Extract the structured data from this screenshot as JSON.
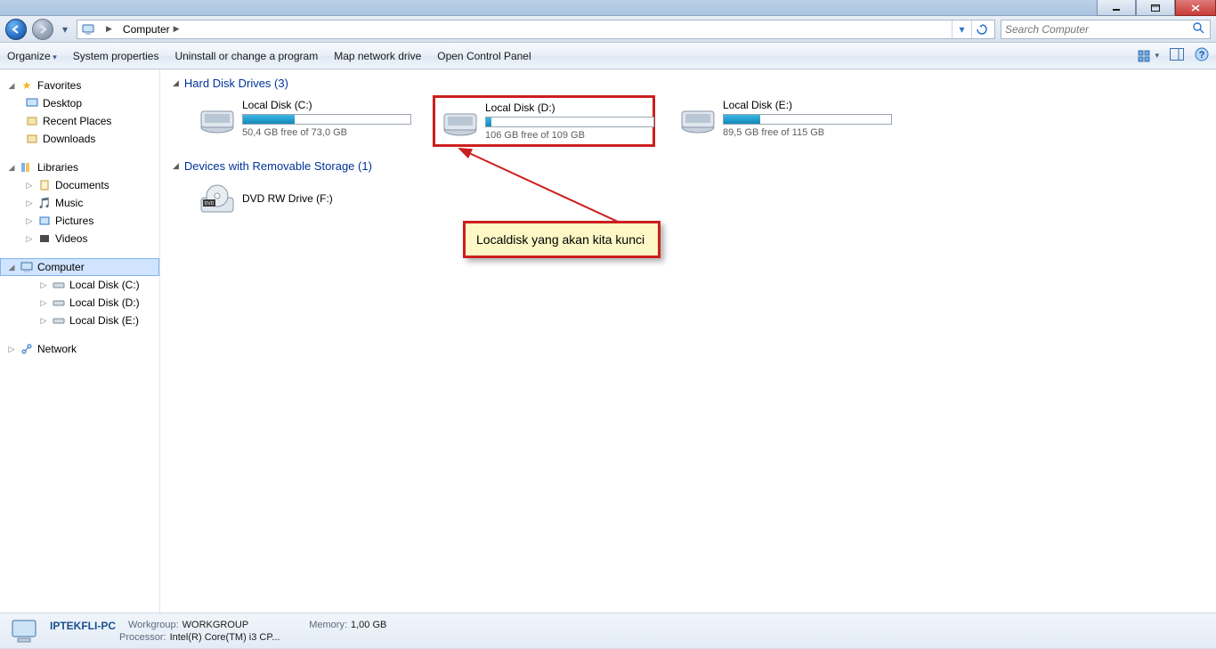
{
  "titlebar": {
    "min": "min",
    "max": "max",
    "close": "close"
  },
  "address": {
    "root_label": "Computer",
    "refresh": "refresh"
  },
  "search": {
    "placeholder": "Search Computer"
  },
  "toolbar": {
    "organize": "Organize",
    "sysprops": "System properties",
    "uninstall": "Uninstall or change a program",
    "mapnet": "Map network drive",
    "opencp": "Open Control Panel"
  },
  "sidebar": {
    "favorites": {
      "label": "Favorites",
      "items": [
        "Desktop",
        "Recent Places",
        "Downloads"
      ]
    },
    "libraries": {
      "label": "Libraries",
      "items": [
        "Documents",
        "Music",
        "Pictures",
        "Videos"
      ]
    },
    "computer": {
      "label": "Computer",
      "items": [
        "Local Disk (C:)",
        "Local Disk (D:)",
        "Local Disk (E:)"
      ]
    },
    "network": {
      "label": "Network"
    }
  },
  "categories": {
    "hdd": {
      "label": "Hard Disk Drives (3)",
      "drives": [
        {
          "name": "Local Disk (C:)",
          "free": "50,4 GB free of 73,0 GB",
          "pct": 31
        },
        {
          "name": "Local Disk (D:)",
          "free": "106 GB free of 109 GB",
          "pct": 3,
          "highlight": true
        },
        {
          "name": "Local Disk (E:)",
          "free": "89,5 GB free of 115 GB",
          "pct": 22
        }
      ]
    },
    "removable": {
      "label": "Devices with Removable Storage (1)",
      "items": [
        {
          "name": "DVD RW Drive (F:)"
        }
      ]
    }
  },
  "annotation": {
    "text": "Localdisk yang akan kita kunci"
  },
  "details": {
    "name": "IPTEKFLI-PC",
    "workgroup_label": "Workgroup:",
    "workgroup": "WORKGROUP",
    "memory_label": "Memory:",
    "memory": "1,00 GB",
    "processor_label": "Processor:",
    "processor": "Intel(R) Core(TM) i3 CP..."
  }
}
